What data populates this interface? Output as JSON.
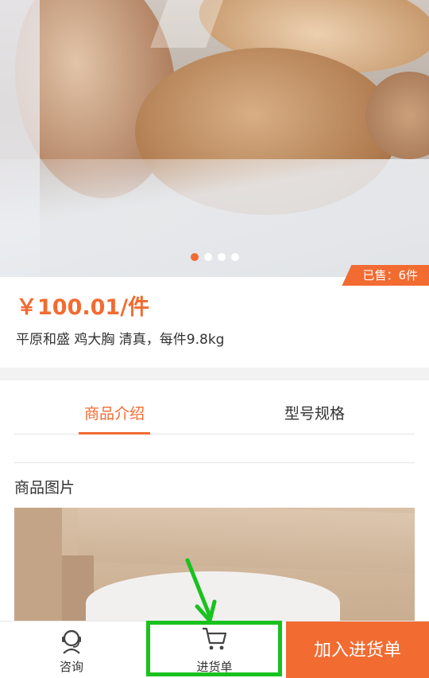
{
  "carousel": {
    "dots": 4,
    "active_index": 0,
    "sold_badge": "已售：6件"
  },
  "product": {
    "price": "￥100.01/件",
    "description": "平原和盛 鸡大胸 清真，每件9.8kg"
  },
  "tabs": [
    {
      "label": "商品介绍",
      "active": true
    },
    {
      "label": "型号规格",
      "active": false
    }
  ],
  "section": {
    "title": "商品图片"
  },
  "bottom_bar": {
    "consult_label": "咨询",
    "cart_label": "进货单",
    "add_button_label": "加入进货单"
  },
  "colors": {
    "accent": "#f26b31",
    "annotation": "#19c21e"
  },
  "icons": {
    "consult": "headset-person-icon",
    "cart": "shopping-cart-icon"
  }
}
